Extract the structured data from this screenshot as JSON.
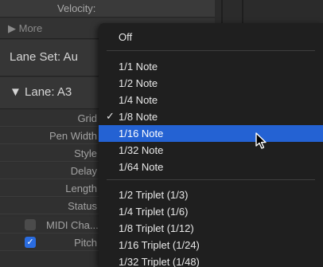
{
  "inspector": {
    "velocity_label": "Velocity:",
    "more_label": "▶ More",
    "lane_set_label": "Lane Set: Au",
    "lane_label": "▼ Lane:  A3",
    "params": [
      "Grid",
      "Pen Width",
      "Style",
      "Delay",
      "Length",
      "Status"
    ],
    "midi_channel": {
      "label": "MIDI Cha...",
      "checked": false
    },
    "pitch": {
      "label": "Pitch",
      "checked": true
    }
  },
  "menu": {
    "items": [
      {
        "label": "Off",
        "checked": false,
        "selected": false
      },
      {
        "label": "1/1 Note",
        "checked": false,
        "selected": false
      },
      {
        "label": "1/2 Note",
        "checked": false,
        "selected": false
      },
      {
        "label": "1/4 Note",
        "checked": false,
        "selected": false
      },
      {
        "label": "1/8 Note",
        "checked": true,
        "selected": false
      },
      {
        "label": "1/16 Note",
        "checked": false,
        "selected": true
      },
      {
        "label": "1/32 Note",
        "checked": false,
        "selected": false
      },
      {
        "label": "1/64 Note",
        "checked": false,
        "selected": false
      },
      {
        "label": "1/2 Triplet (1/3)",
        "checked": false,
        "selected": false
      },
      {
        "label": "1/4 Triplet (1/6)",
        "checked": false,
        "selected": false
      },
      {
        "label": "1/8 Triplet (1/12)",
        "checked": false,
        "selected": false
      },
      {
        "label": "1/16 Triplet (1/24)",
        "checked": false,
        "selected": false
      },
      {
        "label": "1/32 Triplet (1/48)",
        "checked": false,
        "selected": false
      }
    ],
    "checkmark": "✓"
  },
  "colors": {
    "selection": "#2462d3",
    "menu_bg": "#1f1f1f",
    "checkbox_on": "#2a6ce0"
  }
}
